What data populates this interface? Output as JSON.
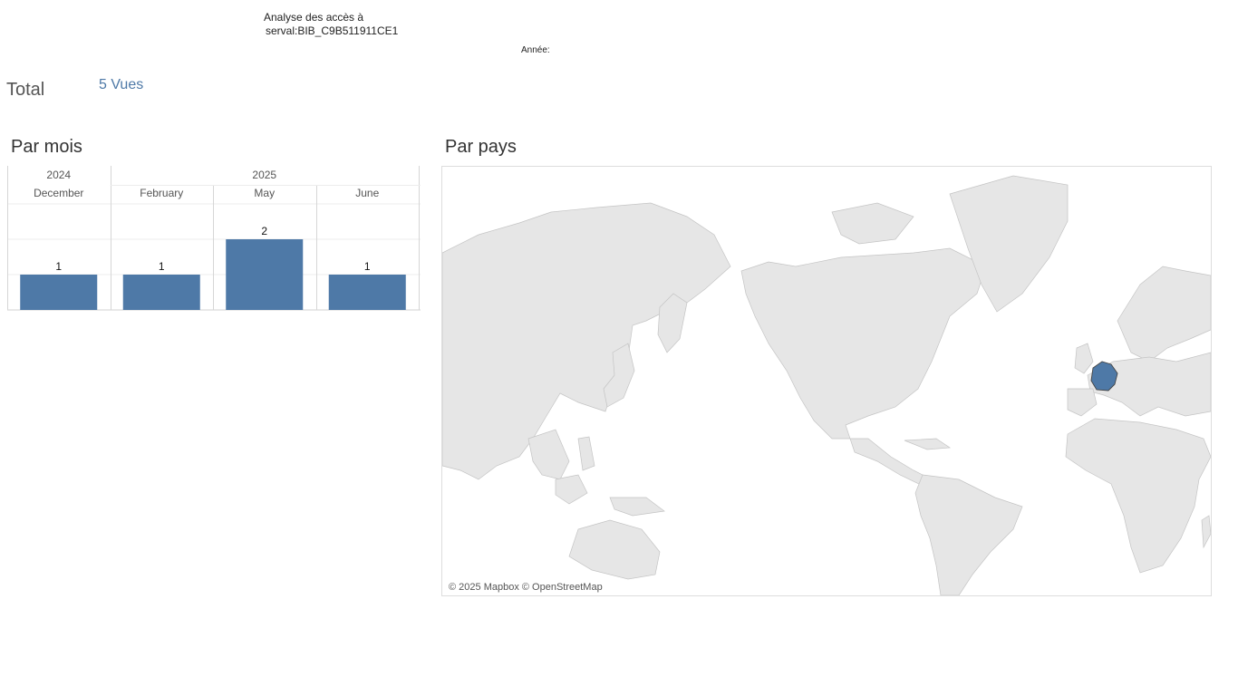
{
  "header": {
    "title_line1": "Analyse des accès à",
    "title_line2": "serval:BIB_C9B511911CE1",
    "year_filter_label": "Année:"
  },
  "total": {
    "label": "Total",
    "value": "5 Vues"
  },
  "sections": {
    "by_month": "Par mois",
    "by_country": "Par pays"
  },
  "chart_data": {
    "type": "bar",
    "years": [
      {
        "label": "2024",
        "span": 1
      },
      {
        "label": "2025",
        "span": 3
      }
    ],
    "categories": [
      "December",
      "February",
      "May",
      "June"
    ],
    "values": [
      1,
      1,
      2,
      1
    ],
    "data_labels": [
      "1",
      "1",
      "2",
      "1"
    ],
    "ylim": [
      0,
      3
    ],
    "grid": true,
    "bar_color": "#4e79a7"
  },
  "map": {
    "highlighted_countries": [
      "France"
    ],
    "highlight_color": "#4e79a7",
    "land_color": "#e6e6e6",
    "attribution": "© 2025 Mapbox © OpenStreetMap"
  }
}
